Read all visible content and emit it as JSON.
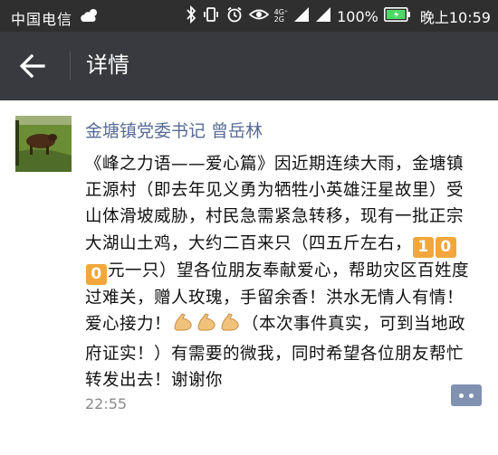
{
  "status_bar": {
    "carrier": "中国电信",
    "network_top": "4G⁺",
    "network_bottom": "2G",
    "battery": "100%",
    "time": "晚上10:59"
  },
  "title_bar": {
    "title": "详情"
  },
  "post": {
    "author": "金塘镇党委书记 曾岳林",
    "text_before_badge": "《峰之力语——爱心篇》因近期连续大雨，金塘镇正源村（即去年见义勇为牺牲小英雄汪星故里）受山体滑坡威胁，村民急需紧急转移，现有一批正宗大湖山土鸡，大约二百来只（四五斤左右，",
    "badge_digits": [
      "1",
      "0",
      "0"
    ],
    "text_middle": "元一只）望各位朋友奉献爱心，帮助灾区百姓度过难关，赠人玫瑰，手留余香！洪水无情人有情！爱心接力！",
    "text_after_emoji": "（本次事件真实，可到当地政府证实！）有需要的微我，同时希望各位朋友帮忙转发出去！谢谢你",
    "emoji": "flexed-biceps-icon",
    "time": "22:55"
  },
  "colors": {
    "status_bar_bg": "#2f2f2f",
    "title_bar_bg": "#393a3f",
    "author_color": "#576b95",
    "badge_color": "#f2a63b",
    "comment_button": "#8191b1"
  }
}
